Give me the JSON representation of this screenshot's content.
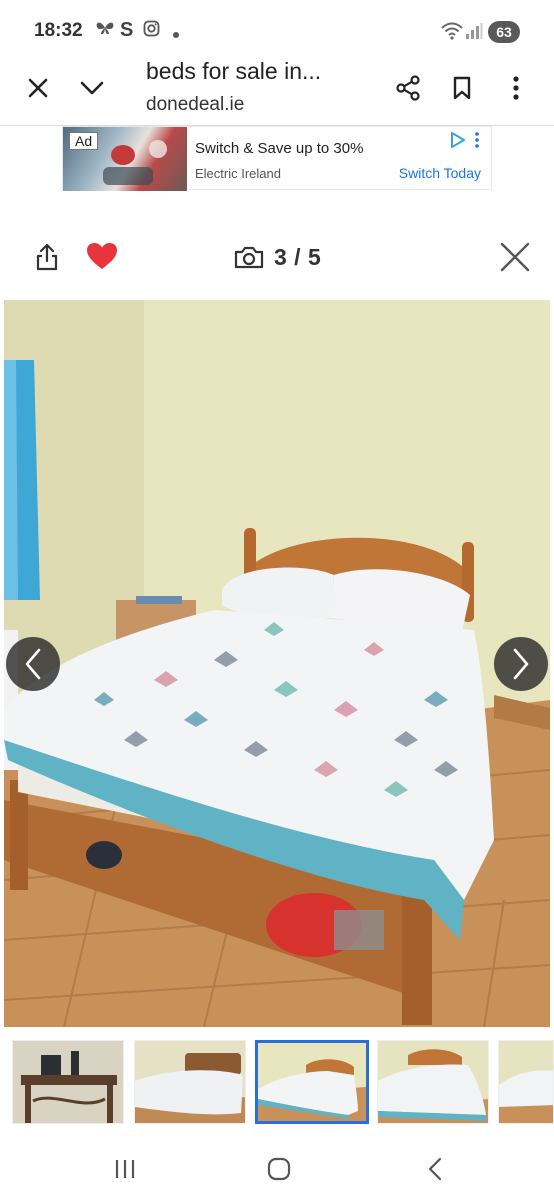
{
  "status_bar": {
    "time": "18:32",
    "battery": "63",
    "icons": [
      "butterfly-icon",
      "s-app-icon",
      "instagram-icon",
      "dot-icon",
      "wifi-icon",
      "signal-icon"
    ]
  },
  "browser": {
    "title": "beds for sale in...",
    "domain": "donedeal.ie",
    "buttons": [
      "close-icon",
      "chevron-down-icon",
      "share-icon",
      "bookmark-icon",
      "more-vert-icon"
    ]
  },
  "ad": {
    "tag": "Ad",
    "headline": "Switch & Save up to 30%",
    "advertiser": "Electric Ireland",
    "cta": "Switch Today"
  },
  "viewer": {
    "counter": "3 / 5",
    "current": 3,
    "total": 5,
    "colors": {
      "heart": "#e8343c",
      "active_border": "#2b6fd6"
    }
  },
  "thumbnails": [
    {
      "subject": "side table with phones"
    },
    {
      "subject": "bed with white duvet"
    },
    {
      "subject": "bed with butterfly duvet",
      "active": true
    },
    {
      "subject": "bed with butterfly duvet"
    },
    {
      "subject": "bed partial"
    }
  ],
  "system_nav": [
    "recents-icon",
    "home-icon",
    "back-icon"
  ]
}
